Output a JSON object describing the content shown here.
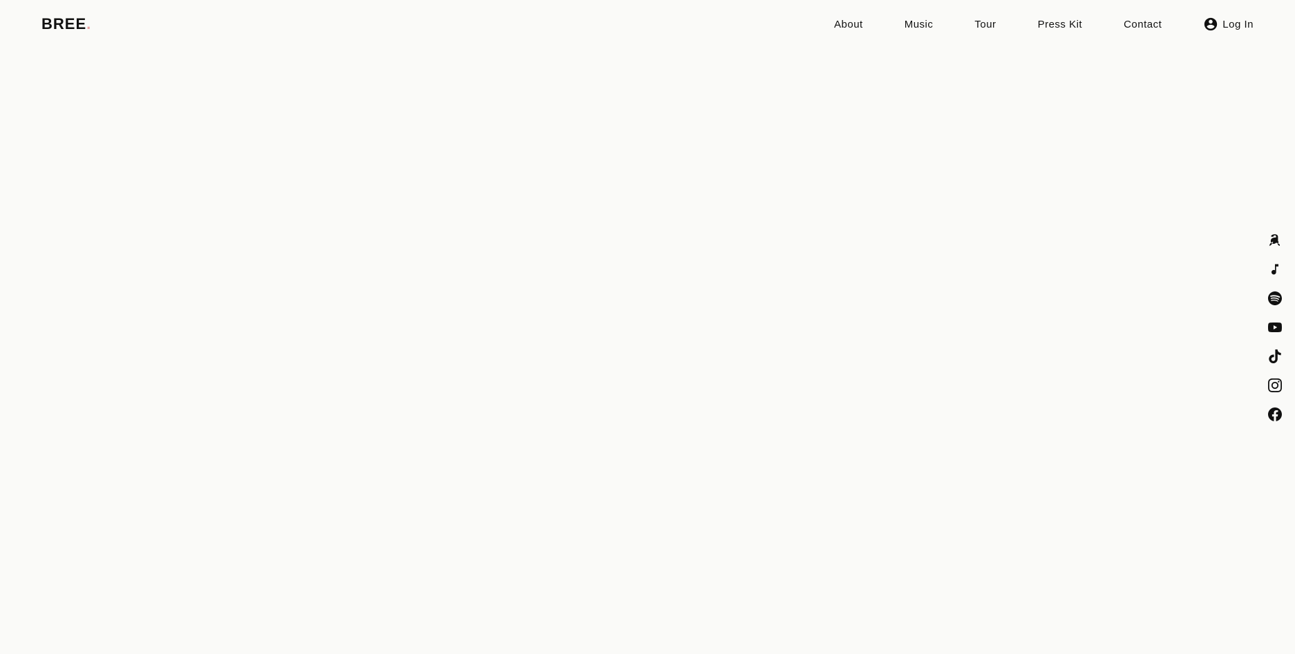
{
  "site": {
    "background_color": "#fafaf8"
  },
  "header": {
    "logo": {
      "text": "BREE",
      "dot": "."
    },
    "nav": {
      "items": [
        {
          "label": "About",
          "id": "about"
        },
        {
          "label": "Music",
          "id": "music"
        },
        {
          "label": "Tour",
          "id": "tour"
        },
        {
          "label": "Press Kit",
          "id": "press-kit"
        },
        {
          "label": "Contact",
          "id": "contact"
        }
      ]
    },
    "login": {
      "label": "Log In"
    }
  },
  "social": {
    "items": [
      {
        "id": "amazon-music",
        "label": "Amazon Music"
      },
      {
        "id": "apple-music",
        "label": "Apple Music"
      },
      {
        "id": "spotify",
        "label": "Spotify"
      },
      {
        "id": "youtube",
        "label": "YouTube"
      },
      {
        "id": "tiktok",
        "label": "TikTok"
      },
      {
        "id": "instagram",
        "label": "Instagram"
      },
      {
        "id": "facebook",
        "label": "Facebook"
      }
    ]
  }
}
